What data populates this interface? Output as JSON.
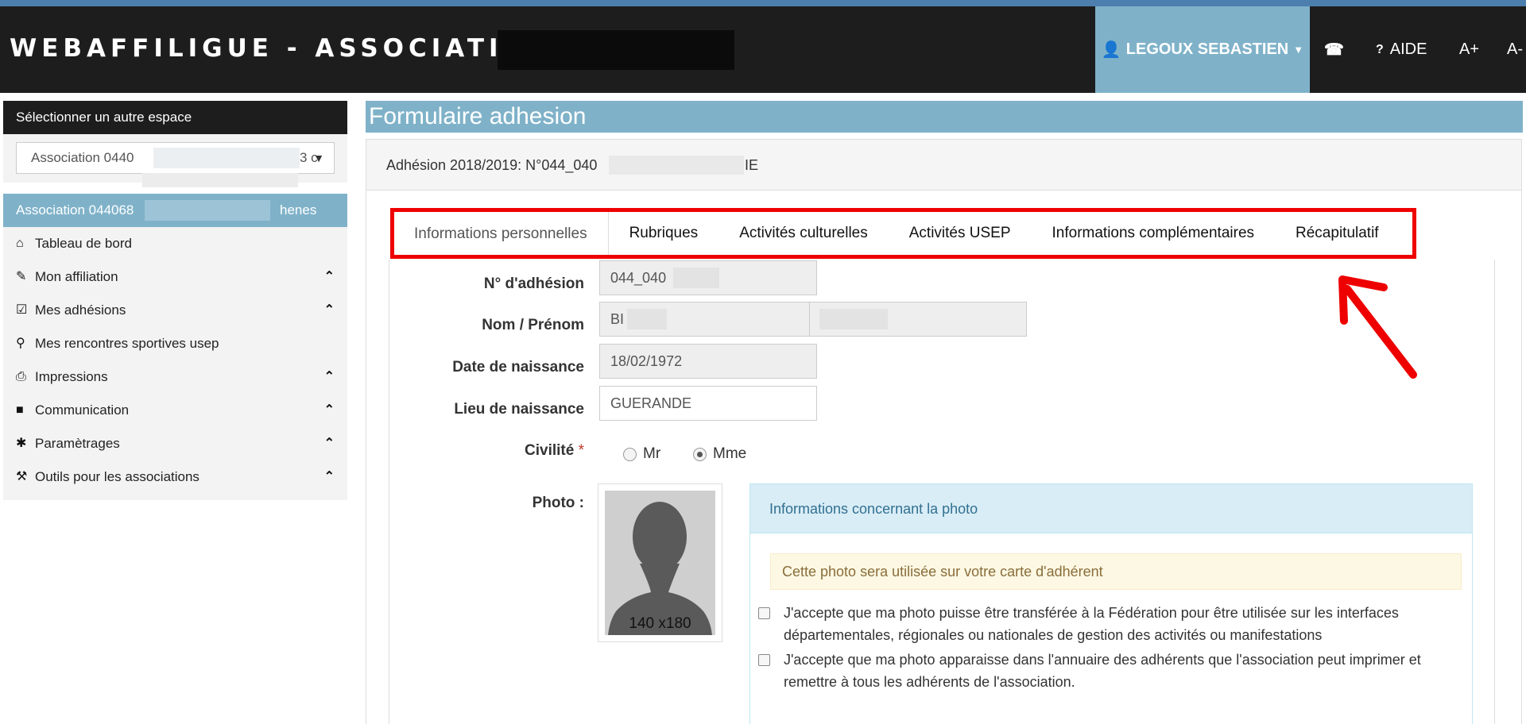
{
  "header": {
    "brand": "WEBAFFILIGUE - ASSOCIATION",
    "user_label": "LEGOUX SEBASTIEN",
    "help_label": "AIDE",
    "font_up": "A+",
    "font_down": "A-"
  },
  "sidebar": {
    "switch_title": "Sélectionner un autre espace",
    "select_value": "Association 0440",
    "select_value_tail": "3 c",
    "current_assoc": "Association 044068",
    "current_assoc_tail": "henes",
    "items": [
      {
        "label": "Tableau de bord",
        "icon": "home-icon",
        "expandable": false
      },
      {
        "label": "Mon affiliation",
        "icon": "pencil-icon",
        "expandable": true
      },
      {
        "label": "Mes adhésions",
        "icon": "edit-icon",
        "expandable": true
      },
      {
        "label": "Mes rencontres sportives usep",
        "icon": "map-marker-icon",
        "expandable": false
      },
      {
        "label": "Impressions",
        "icon": "printer-icon",
        "expandable": true
      },
      {
        "label": "Communication",
        "icon": "comment-icon",
        "expandable": true
      },
      {
        "label": "Paramètrages",
        "icon": "cog-icon",
        "expandable": true
      },
      {
        "label": "Outils pour les associations",
        "icon": "wrench-icon",
        "expandable": true
      }
    ]
  },
  "main": {
    "title": "Formulaire adhesion",
    "panel_heading": "Adhésion 2018/2019: N°044_040",
    "panel_heading_tail": "IE",
    "tabs": [
      {
        "label": "Informations personnelles",
        "active": true
      },
      {
        "label": "Rubriques",
        "active": false
      },
      {
        "label": "Activités culturelles",
        "active": false
      },
      {
        "label": "Activités USEP",
        "active": false
      },
      {
        "label": "Informations complémentaires",
        "active": false
      },
      {
        "label": "Récapitulatif",
        "active": false
      }
    ],
    "form": {
      "adhesion_label": "N° d'adhésion",
      "adhesion_value": "044_040",
      "name_label": "Nom / Prénom",
      "name_value": "BI",
      "birthdate_label": "Date de naissance",
      "birthdate_value": "18/02/1972",
      "birthplace_label": "Lieu de naissance",
      "birthplace_value": "GUERANDE",
      "civility_label": "Civilité",
      "civility_required": "*",
      "civility_options": [
        "Mr",
        "Mme"
      ],
      "civility_selected": "Mme",
      "photo_label": "Photo :",
      "photo_placeholder": "140 x180"
    },
    "photo_info": {
      "heading": "Informations concernant la photo",
      "notice": "Cette photo sera utilisée sur votre carte d'adhérent",
      "consent_1": "J'accepte que ma photo puisse être transférée à la Fédération pour être utilisée sur les interfaces départementales, régionales ou nationales de gestion des activités ou manifestations",
      "consent_2": "J'accepte que ma photo apparaisse dans l'annuaire des adhérents que l'association peut imprimer et remettre à tous les adhérents de l'association."
    }
  },
  "colors": {
    "accent": "#7fb2c9",
    "topbar": "#1d1d1d",
    "highlight": "#ee0000"
  }
}
